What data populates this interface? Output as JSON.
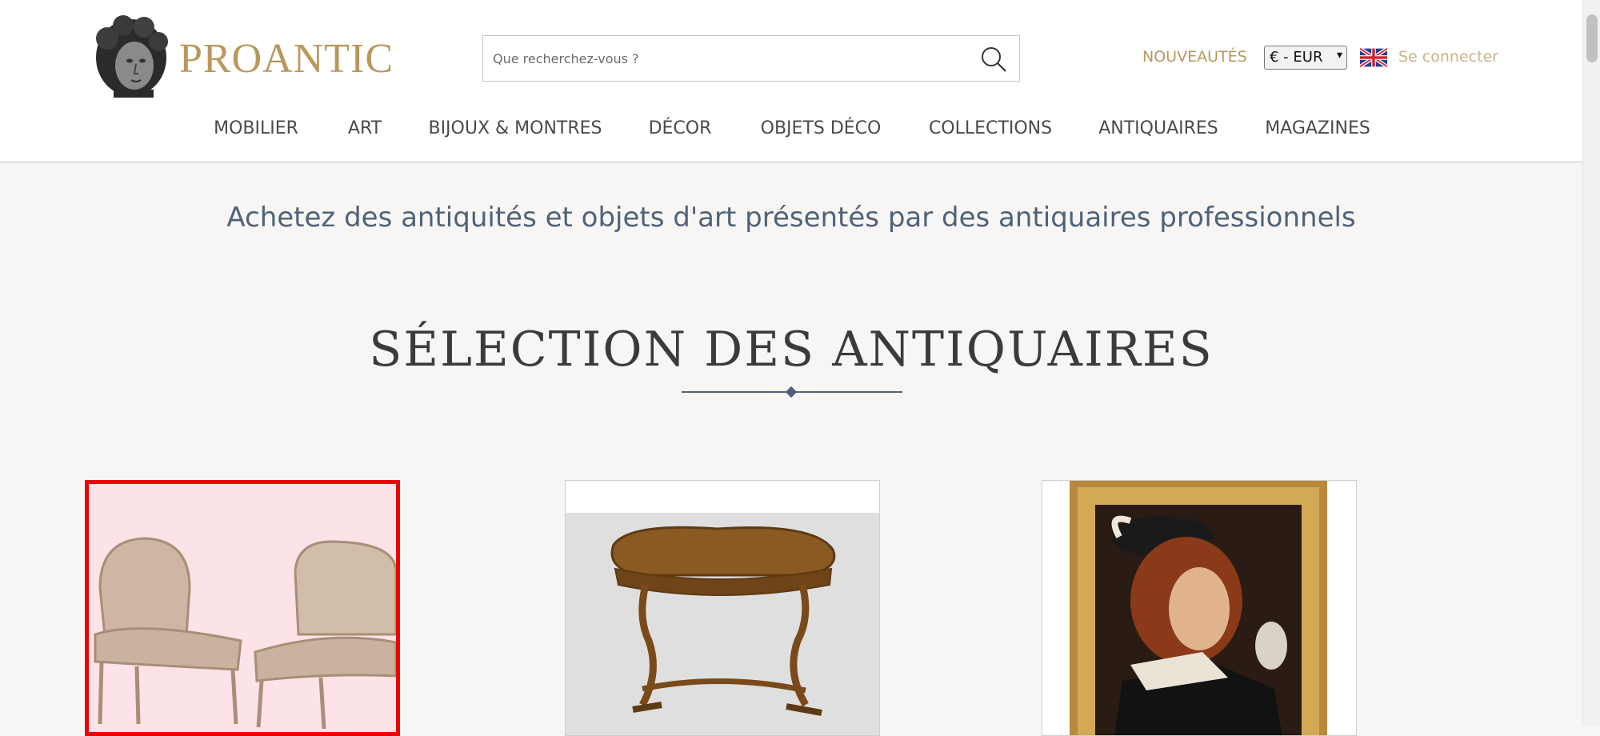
{
  "header": {
    "brand": "PROANTIC",
    "search": {
      "placeholder": "Que recherchez-vous ?",
      "value": ""
    },
    "nouveautes_label": "NOUVEAUTÉS",
    "currency_selected": "€ - EUR",
    "login_label": "Se connecter",
    "language_flag": "uk-flag-icon"
  },
  "nav": {
    "items": [
      {
        "label": "MOBILIER"
      },
      {
        "label": "ART"
      },
      {
        "label": "BIJOUX & MONTRES"
      },
      {
        "label": "DÉCOR"
      },
      {
        "label": "OBJETS DÉCO"
      },
      {
        "label": "COLLECTIONS"
      },
      {
        "label": "ANTIQUAIRES"
      },
      {
        "label": "MAGAZINES"
      }
    ]
  },
  "main": {
    "tagline": "Achetez des antiquités et objets d'art présentés par des antiquaires professionnels",
    "section_title": "SÉLECTION DES ANTIQUAIRES",
    "cards": [
      {
        "subject": "pair of upholstered armchairs",
        "selected": true
      },
      {
        "subject": "kidney-shaped writing table"
      },
      {
        "subject": "portrait painting in gilded frame"
      }
    ]
  },
  "colors": {
    "brand_gold": "#b8985c",
    "accent_blue": "#4f6278",
    "highlight_red": "#ee0000",
    "background": "#f7f6f4"
  }
}
